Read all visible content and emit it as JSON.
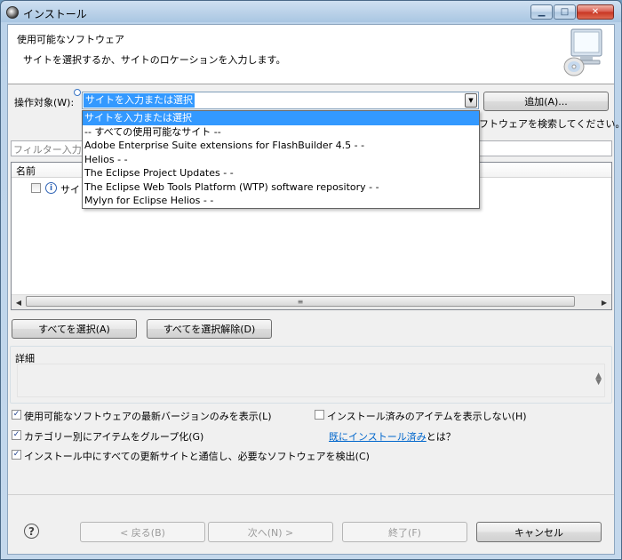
{
  "window": {
    "title": "インストール"
  },
  "header": {
    "title": "使用可能なソフトウェア",
    "description": "サイトを選択するか、サイトのロケーションを入力します。"
  },
  "work_with": {
    "label": "操作対象(W):",
    "value": "サイトを入力または選択",
    "add_button": "追加(A)...",
    "hint_partial": "フトウェアを検索してください。",
    "options": [
      "サイトを入力または選択",
      "-- すべての使用可能なサイト --",
      "Adobe Enterprise Suite extensions for FlashBuilder 4.5 -  -",
      "Helios -  -",
      "The Eclipse Project Updates -  -",
      "The Eclipse Web Tools Platform (WTP) software repository -  -",
      "Mylyn for Eclipse Helios -  -"
    ]
  },
  "filter": {
    "placeholder": "フィルター入力"
  },
  "tree": {
    "column_name": "名前",
    "row_text": "サイ"
  },
  "buttons": {
    "select_all": "すべてを選択(A)",
    "deselect_all": "すべてを選択解除(D)",
    "back": "< 戻る(B)",
    "next": "次へ(N) >",
    "finish": "終了(F)",
    "cancel": "キャンセル"
  },
  "details": {
    "label": "詳細"
  },
  "options": {
    "latest_only": "使用可能なソフトウェアの最新バージョンのみを表示(L)",
    "hide_installed": "インストール済みのアイテムを表示しない(H)",
    "group_by_category": "カテゴリー別にアイテムをグループ化(G)",
    "already_installed_link": "既にインストール済み",
    "already_installed_suffix": "とは？",
    "contact_all_sites": "インストール中にすべての更新サイトと通信し、必要なソフトウェアを検出(C)"
  }
}
